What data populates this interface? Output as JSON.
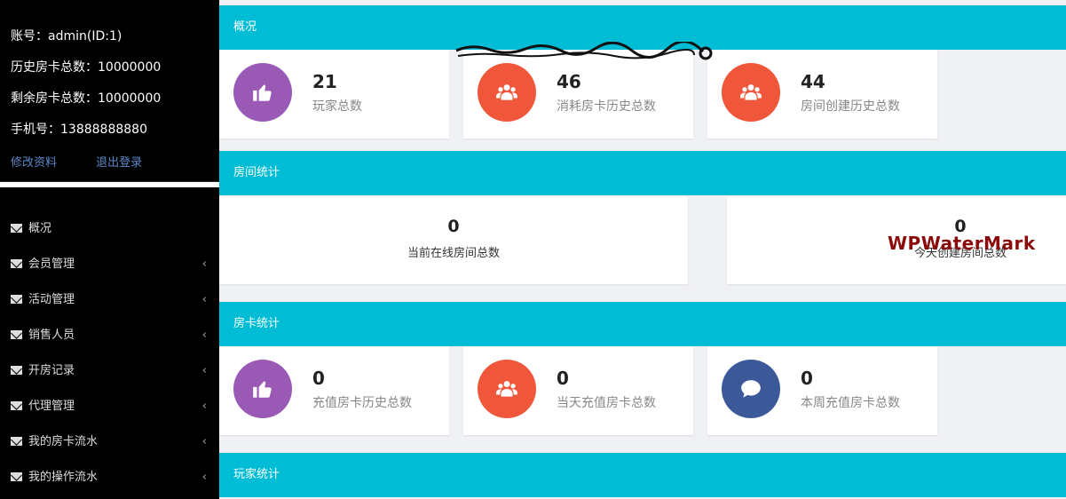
{
  "user": {
    "account": "账号：admin(ID:1)",
    "history_cards": "历史房卡总数：10000000",
    "remaining_cards": "剩余房卡总数：10000000",
    "phone": "手机号：13888888880",
    "edit_link": "修改资料",
    "logout_link": "退出登录"
  },
  "nav": [
    {
      "label": "概况",
      "has_chevron": false
    },
    {
      "label": "会员管理",
      "has_chevron": true
    },
    {
      "label": "活动管理",
      "has_chevron": true
    },
    {
      "label": "销售人员",
      "has_chevron": true
    },
    {
      "label": "开房记录",
      "has_chevron": true
    },
    {
      "label": "代理管理",
      "has_chevron": true
    },
    {
      "label": "我的房卡流水",
      "has_chevron": true
    },
    {
      "label": "我的操作流水",
      "has_chevron": true
    }
  ],
  "chevron_glyph": "‹",
  "sections": {
    "overview": "概况",
    "room_stats": "房间统计",
    "card_stats": "房卡统计",
    "player_stats": "玩家统计"
  },
  "overview_cards": [
    {
      "value": "21",
      "label": "玩家总数",
      "icon": "thumbs-up-icon",
      "color": "#9b59b6"
    },
    {
      "value": "46",
      "label": "消耗房卡历史总数",
      "icon": "users-icon",
      "color": "#f0573a"
    },
    {
      "value": "44",
      "label": "房间创建历史总数",
      "icon": "users-icon",
      "color": "#f0573a"
    }
  ],
  "room_cards": [
    {
      "value": "0",
      "label": "当前在线房间总数"
    },
    {
      "value": "0",
      "label": "今天创建房间总数"
    }
  ],
  "card_cards": [
    {
      "value": "0",
      "label": "充值房卡历史总数",
      "icon": "thumbs-up-icon",
      "color": "#9b59b6"
    },
    {
      "value": "0",
      "label": "当天充值房卡总数",
      "icon": "users-icon",
      "color": "#f0573a"
    },
    {
      "value": "0",
      "label": "本周充值房卡总数",
      "icon": "comment-icon",
      "color": "#3b5998"
    }
  ],
  "watermark": "WPWaterMark",
  "colors": {
    "accent": "#00bcd4",
    "sidebar": "#000000",
    "link": "#5b87c7"
  }
}
